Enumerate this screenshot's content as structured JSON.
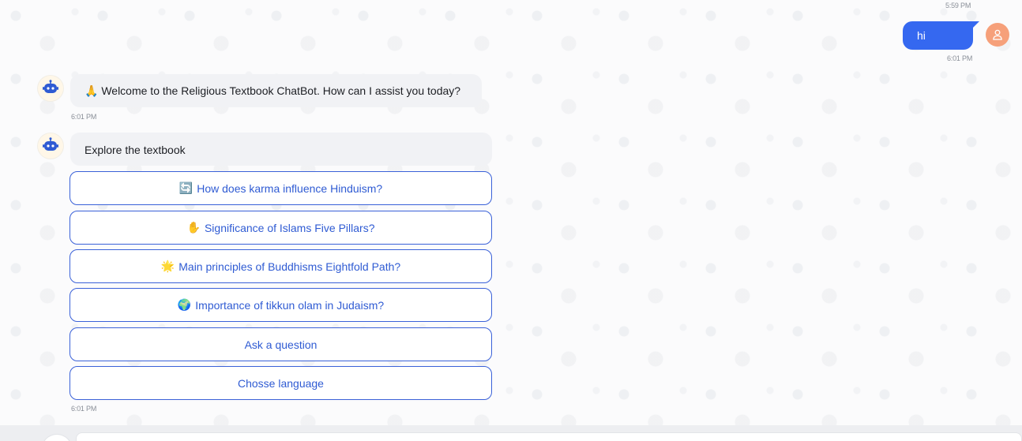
{
  "user_message": {
    "text": "hi",
    "sent_time": "5:59 PM",
    "time": "6:01 PM"
  },
  "bot_welcome": {
    "emoji": "🙏",
    "text": "Welcome to the Religious Textbook ChatBot. How can I assist you today?",
    "time": "6:01 PM"
  },
  "bot_menu": {
    "title": "Explore the textbook",
    "time": "6:01 PM",
    "options": [
      {
        "emoji": "🔄",
        "label": "How does karma influence Hinduism?"
      },
      {
        "emoji": "✋",
        "label": "Significance of Islams Five Pillars?"
      },
      {
        "emoji": "🌟",
        "label": "Main principles of Buddhisms Eightfold Path?"
      },
      {
        "emoji": "🌍",
        "label": "Importance of tikkun olam in Judaism?"
      },
      {
        "emoji": "",
        "label": "Ask a question"
      },
      {
        "emoji": "",
        "label": "Chosse language"
      }
    ]
  },
  "colors": {
    "accent": "#3568f0",
    "user_avatar": "#f6a07a",
    "bot_bubble": "#f1f2f5",
    "option_border": "#3a61d8"
  },
  "icons": {
    "user_avatar": "user-icon",
    "bot_avatar": "robot-icon"
  }
}
